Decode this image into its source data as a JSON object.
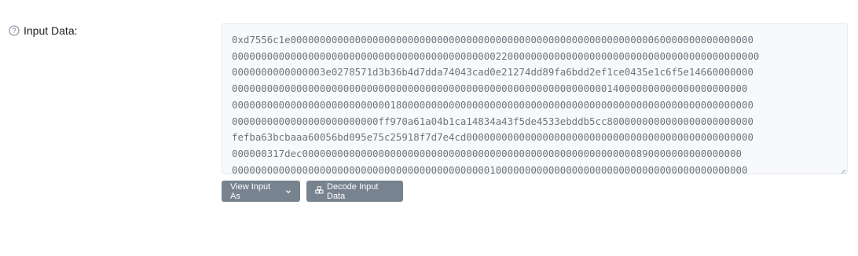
{
  "field": {
    "label": "Input Data:",
    "help_icon": "question-circle-icon",
    "lines": [
      "0xd7556c1e0000000000000000000000000000000000000000000000000000000000000060000000000000000",
      "000000000000000000000000000000000000000000000220000000000000000000000000000000000000000000",
      "0000000000000003e0278571d3b36b4d7dda74043cad0e21274dd89fa6bdd2ef1ce0435e1c6f5e14660000000",
      "0000000000000000000000000000000000000000000000000000000000000000140000000000000000000000",
      "00000000000000000000000000018000000000000000000000000000000000000000000000000000000000000",
      "0000000000000000000000000ff970a61a04b1ca14834a43f5de4533ebddb5cc8000000000000000000000000",
      "fefba63bcbaaa60056bd095e75c25918f7d7e4cd0000000000000000000000000000000000000000000000000",
      "000000317dec000000000000000000000000000000000000000000000000000000000890000000000000000",
      "0000000000000000000000000000000000000000000010000000000000000000000000000000000000000000"
    ]
  },
  "buttons": {
    "view_input_as": "View Input As",
    "decode_input_data": "Decode Input Data",
    "view_icon": "chevron-down-icon",
    "decode_icon": "cubes-icon"
  }
}
